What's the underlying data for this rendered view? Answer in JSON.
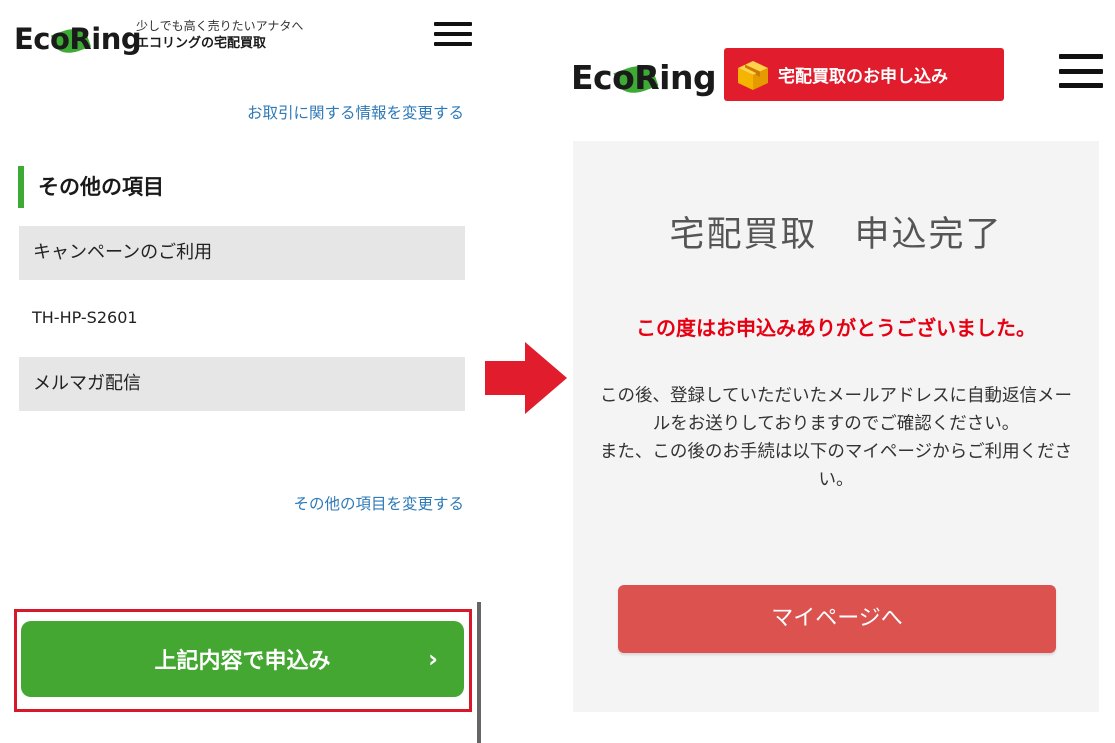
{
  "brand": {
    "logo_text": "EcoRing",
    "tagline_line1": "少しでも高く売りたいアナタへ",
    "tagline_line2": "エコリングの宅配買取",
    "leaf_color": "#3daa35"
  },
  "left_screen": {
    "change_trade_info_link": "お取引に関する情報を変更する",
    "section_heading": "その他の項目",
    "campaign_label": "キャンペーンのご利用",
    "campaign_value": "TH-HP-S2601",
    "newsletter_label": "メルマガ配信",
    "change_other_link": "その他の項目を変更する",
    "submit_button": "上記内容で申込み",
    "submit_chevron": "›",
    "submit_color": "#43a732",
    "highlight_color": "#d7182a",
    "menu_icon": "hamburger-icon"
  },
  "transition_arrow": {
    "icon": "right-arrow-icon",
    "color": "#e11d2d"
  },
  "right_screen": {
    "apply_banner": "宅配買取のお申し込み",
    "apply_banner_icon": "cardboard-box-icon",
    "apply_banner_color": "#e11d2d",
    "completion_title": "宅配買取　申込完了",
    "thanks_message": "この度はお申込みありがとうございました。",
    "message_paragraph1": "この後、登録していただいたメールアドレスに自動返信メールをお送りしておりますのでご確認ください。",
    "message_paragraph2": "また、この後のお手続は以下のマイページからご利用ください。",
    "mypage_button": "マイページへ",
    "mypage_color": "#db524f",
    "menu_icon": "hamburger-icon"
  }
}
